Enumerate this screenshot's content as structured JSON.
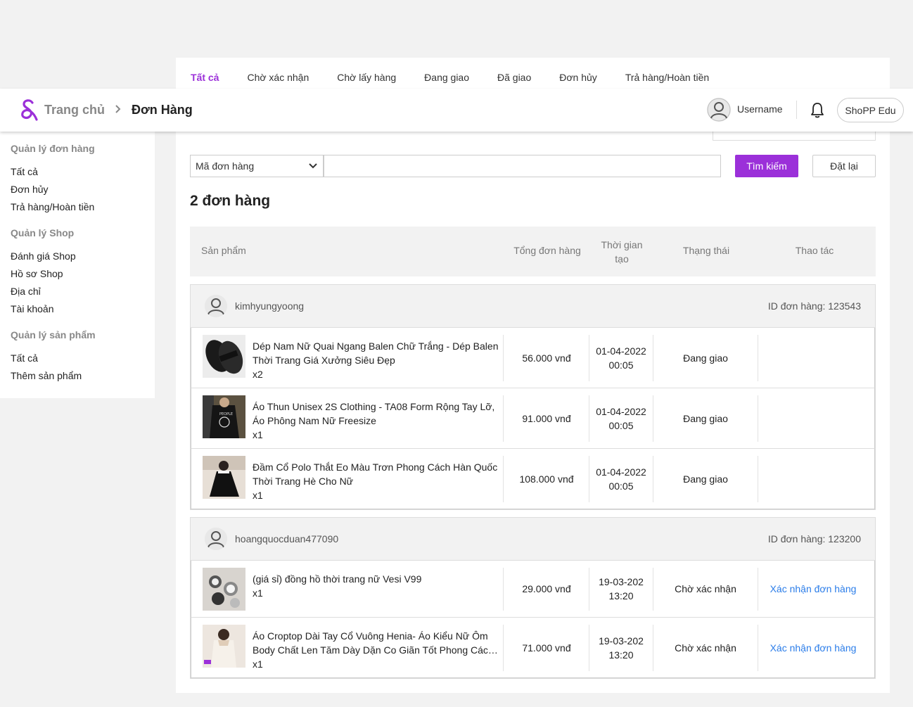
{
  "tabs": [
    "Tất cả",
    "Chờ xác nhận",
    "Chờ lấy hàng",
    "Đang giao",
    "Đã giao",
    "Đơn hủy",
    "Trả hàng/Hoàn tiền"
  ],
  "header": {
    "breadcrumb_home": "Trang chủ",
    "breadcrumb_current": "Đơn Hàng",
    "username": "Username",
    "shop_button": "ShoPP Edu"
  },
  "sidebar": {
    "groups": [
      {
        "title": "Quản lý đơn hàng",
        "items": [
          "Tất cả",
          "Đơn hủy",
          "Trả hàng/Hoàn tiền"
        ]
      },
      {
        "title": "Quản lý Shop",
        "items": [
          "Đánh giá Shop",
          "Hồ sơ Shop",
          "Địa chỉ",
          "Tài khoản"
        ]
      },
      {
        "title": "Quản lý sản phẩm",
        "items": [
          "Tất cả",
          "Thêm sản phẩm"
        ]
      }
    ]
  },
  "search": {
    "select_value": "Mã đơn hàng",
    "input_value": "",
    "search_label": "Tìm kiếm",
    "reset_label": "Đặt lại"
  },
  "order_count": "2 đơn hàng",
  "table_header": {
    "product": "Sản phẩm",
    "total": "Tổng đơn hàng",
    "time": "Thời gian tạo",
    "status": "Thạng thái",
    "action": "Thao tác"
  },
  "orders": [
    {
      "buyer": "kimhyungyoong",
      "order_id": "ID đơn hàng: 123543",
      "items": [
        {
          "name": "Dép Nam Nữ Quai Ngang Balen Chữ Trắng - Dép Balen Thời Trang Giá Xưởng Siêu Đẹp",
          "qty": "x2",
          "price": "56.000 vnđ",
          "date": "01-04-2022",
          "time": "00:05",
          "status": "Đang giao",
          "action": ""
        },
        {
          "name": "Áo Thun Unisex 2S Clothing - TA08 Form Rộng Tay Lỡ, Áo Phông Nam Nữ Freesize",
          "qty": "x1",
          "price": "91.000 vnđ",
          "date": "01-04-2022",
          "time": "00:05",
          "status": "Đang giao",
          "action": ""
        },
        {
          "name": "Đầm Cổ Polo Thắt Eo Màu Trơn Phong Cách Hàn Quốc Thời Trang Hè Cho Nữ",
          "qty": "x1",
          "price": "108.000 vnđ",
          "date": "01-04-2022",
          "time": "00:05",
          "status": "Đang giao",
          "action": ""
        }
      ]
    },
    {
      "buyer": "hoangquocduan477090",
      "order_id": "ID đơn hàng: 123200",
      "items": [
        {
          "name": "(giá sỉ) đồng hồ thời trang nữ Vesi V99",
          "qty": "x1",
          "price": "29.000 vnđ",
          "date": "19-03-202",
          "time": "13:20",
          "status": "Chờ xác nhận",
          "action": "Xác nhận đơn hàng"
        },
        {
          "name": "Áo Croptop Dài Tay Cổ Vuông Henia- Áo Kiểu Nữ Ôm Body Chất Len Tăm Dày Dặn Co Giãn Tốt Phong Cách Hàn Quốc",
          "qty": "x1",
          "price": "71.000 vnđ",
          "date": "19-03-202",
          "time": "13:20",
          "status": "Chờ xác nhận",
          "action": "Xác nhận đơn hàng"
        }
      ]
    }
  ],
  "colors": {
    "accent": "#9b30d9",
    "link": "#2b7de9"
  },
  "icons": [
    "logo-icon",
    "chevron-right-icon",
    "user-avatar-icon",
    "bell-icon",
    "chevron-down-icon",
    "buyer-avatar-icon"
  ]
}
